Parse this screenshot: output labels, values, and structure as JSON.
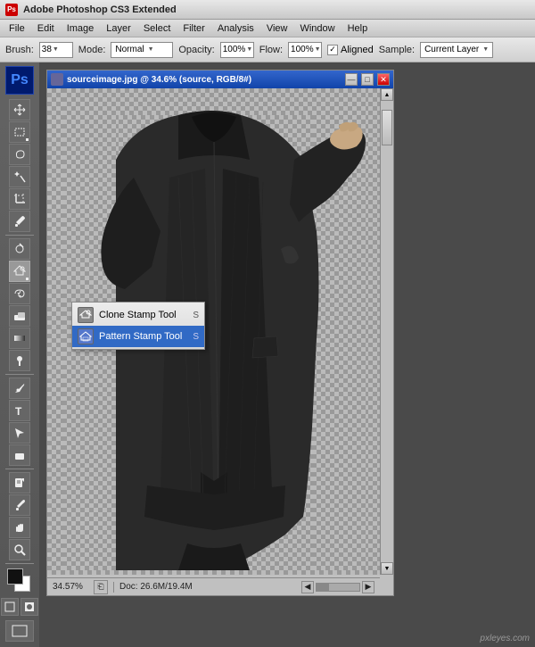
{
  "app": {
    "title": "Adobe Photoshop CS3 Extended",
    "logo": "Ps"
  },
  "title_bar": {
    "text": "Adobe Photoshop CS3 Extended"
  },
  "menu": {
    "items": [
      "File",
      "Edit",
      "Image",
      "Layer",
      "Select",
      "Filter",
      "Analysis",
      "View",
      "Window",
      "Help"
    ]
  },
  "options_bar": {
    "brush_label": "Brush:",
    "brush_value": "38",
    "mode_label": "Mode:",
    "mode_value": "Normal",
    "opacity_label": "Opacity:",
    "opacity_value": "100%",
    "flow_label": "Flow:",
    "flow_value": "100%",
    "aligned_label": "Aligned",
    "sample_label": "Sample:",
    "sample_value": "Current Layer"
  },
  "document": {
    "title": "sourceimage.jpg @ 34.6% (source, RGB/8#)",
    "zoom": "34.57%",
    "doc_info": "Doc: 26.6M/19.4M"
  },
  "context_menu": {
    "items": [
      {
        "label": "Clone Stamp Tool",
        "key": "S",
        "icon": "stamp"
      },
      {
        "label": "Pattern Stamp Tool",
        "key": "S",
        "icon": "pattern-stamp"
      }
    ]
  },
  "tools": [
    "move",
    "marquee",
    "lasso",
    "magic-wand",
    "crop",
    "eyedropper",
    "healing-brush",
    "clone-stamp",
    "history-brush",
    "eraser",
    "gradient",
    "dodge",
    "pen",
    "type",
    "path-selection",
    "shape",
    "notes",
    "eyedropper2",
    "hand",
    "zoom"
  ],
  "watermark": "pxleyes.com",
  "window_controls": {
    "minimize": "—",
    "maximize": "□",
    "close": "✕"
  }
}
